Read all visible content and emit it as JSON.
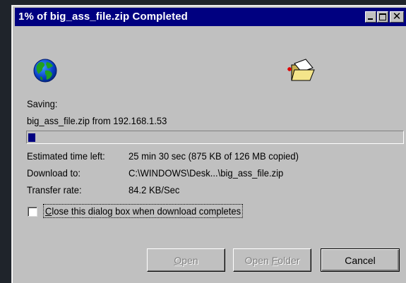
{
  "window": {
    "title": "1% of big_ass_file.zip Completed",
    "controls": {
      "minimize_icon": "minimize-icon",
      "maximize_icon": "maximize-icon",
      "close_glyph": "✕"
    }
  },
  "icons": {
    "source": "globe-icon",
    "destination": "open-folder-icon"
  },
  "saving": {
    "label": "Saving:",
    "detail": "big_ass_file.zip from 192.168.1.53"
  },
  "progress": {
    "fraction": 0.01,
    "color": "#000080"
  },
  "info": {
    "time_left_label": "Estimated time left:",
    "time_left_value": "25 min 30 sec (875 KB of 126 MB copied)",
    "download_to_label": "Download to:",
    "download_to_value": "C:\\WINDOWS\\Desk...\\big_ass_file.zip",
    "transfer_rate_label": "Transfer rate:",
    "transfer_rate_value": "84.2 KB/Sec"
  },
  "options": {
    "close_on_complete": {
      "label": "Close this dialog box when download completes",
      "accel_char": "C",
      "label_rest": "lose this dialog box when download completes",
      "checked": false
    }
  },
  "buttons": {
    "open": {
      "accel": "O",
      "rest": "pen",
      "label": "Open",
      "enabled": false
    },
    "open_folder": {
      "pre": "Open ",
      "accel": "F",
      "rest": "older",
      "label": "Open Folder",
      "enabled": false
    },
    "cancel": {
      "label": "Cancel",
      "enabled": true
    }
  },
  "colors": {
    "titlebar": "#000080",
    "face": "#c0c0c0",
    "backdrop": "#1f242b"
  }
}
